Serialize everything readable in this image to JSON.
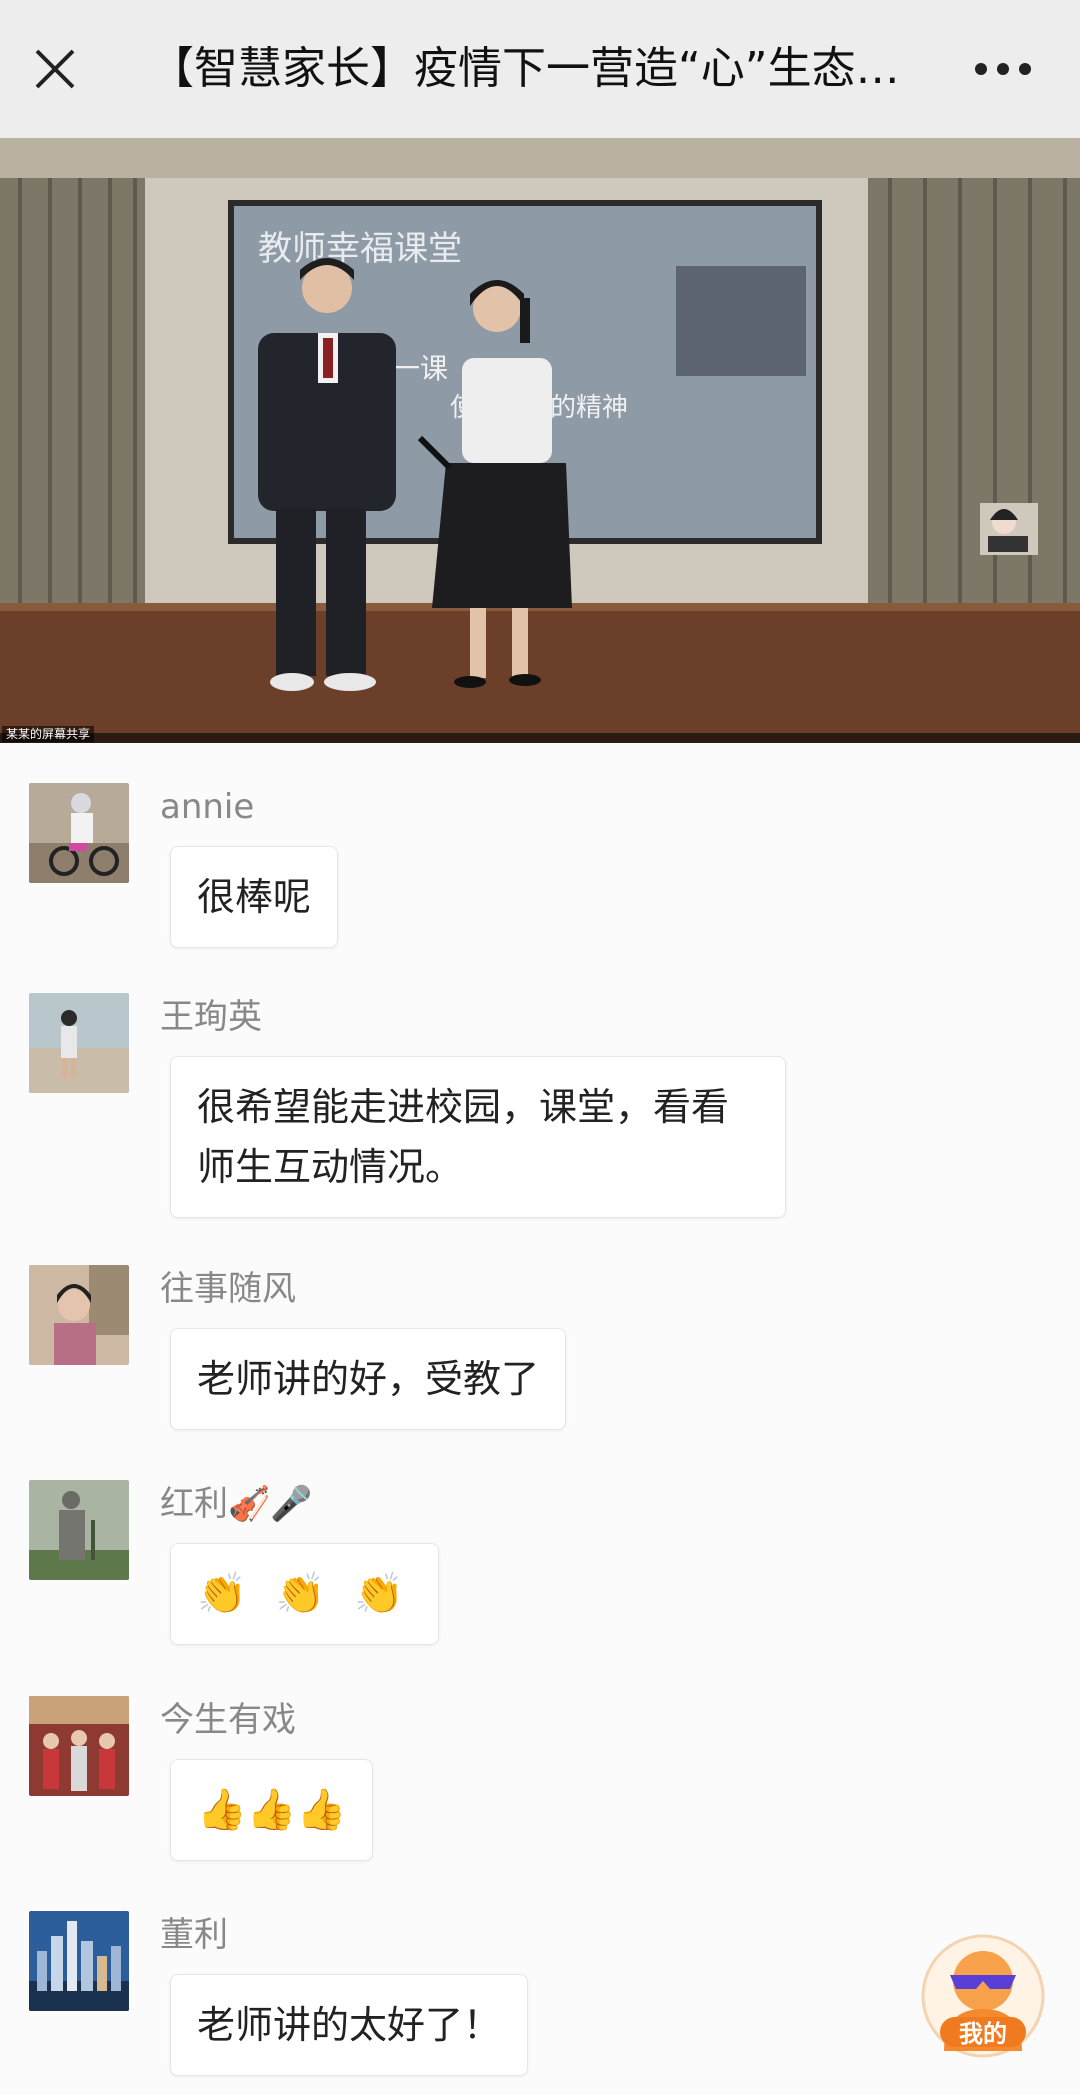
{
  "window": {
    "title": "【智慧家长】疫情下一营造“心”生态…",
    "close_icon": "close-icon",
    "more_icon": "more-dots-icon"
  },
  "video": {
    "screen_title": "教师幸福课堂",
    "screen_line1": "一课",
    "screen_line2": "使命",
    "screen_line3": "的精神",
    "share_label": "某某的屏幕共享"
  },
  "comments": [
    {
      "name": "annie",
      "text": "很棒呢",
      "avatar": "avatar-cyclist"
    },
    {
      "name": "王珣英",
      "text_line1": "很希望能走进校园，课堂，看看",
      "text_line2": "师生互动情况。",
      "avatar": "avatar-beach"
    },
    {
      "name": "往事随风",
      "text": "老师讲的好，受教了",
      "avatar": "avatar-girl"
    },
    {
      "name": "红利🎻🎤",
      "text": "👏 👏 👏",
      "avatar": "avatar-statue"
    },
    {
      "name": "今生有戏",
      "text": "👍👍👍",
      "avatar": "avatar-group"
    },
    {
      "name": "董利",
      "text": "老师讲的太好了！",
      "avatar": "avatar-city"
    }
  ],
  "mine_button": {
    "label": "我的",
    "icon": "sunglasses-avatar-icon"
  }
}
